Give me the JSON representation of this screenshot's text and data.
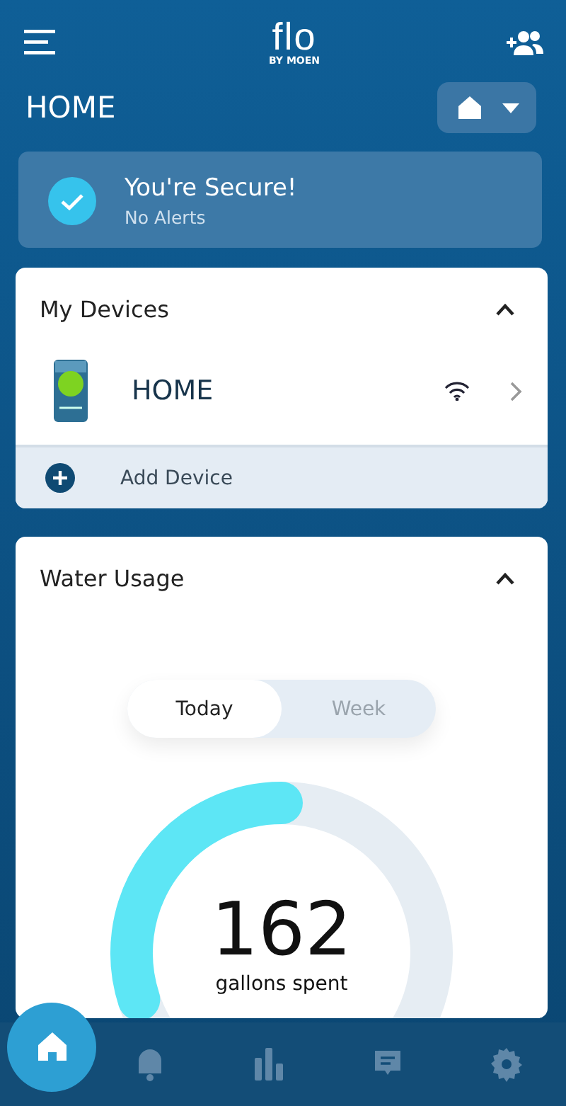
{
  "header": {
    "logo": "flo",
    "logo_sub": "BY MOEN"
  },
  "location": {
    "title": "HOME"
  },
  "status": {
    "title": "You're Secure!",
    "subtitle": "No Alerts",
    "secure": true
  },
  "devices": {
    "title": "My Devices",
    "expanded": true,
    "items": [
      {
        "name": "HOME",
        "online": true
      }
    ],
    "add_label": "Add Device"
  },
  "water_usage": {
    "title": "Water Usage",
    "expanded": true,
    "tabs": [
      {
        "label": "Today",
        "selected": true
      },
      {
        "label": "Week",
        "selected": false
      }
    ],
    "gauge": {
      "level": 0.3,
      "value": "162",
      "unit": "gallons spent"
    }
  },
  "nav": [
    {
      "kind": "home",
      "selected": true
    },
    {
      "kind": "alerts",
      "selected": false
    },
    {
      "kind": "usage",
      "selected": false
    },
    {
      "kind": "messages",
      "selected": false
    },
    {
      "kind": "settings",
      "selected": false
    }
  ]
}
